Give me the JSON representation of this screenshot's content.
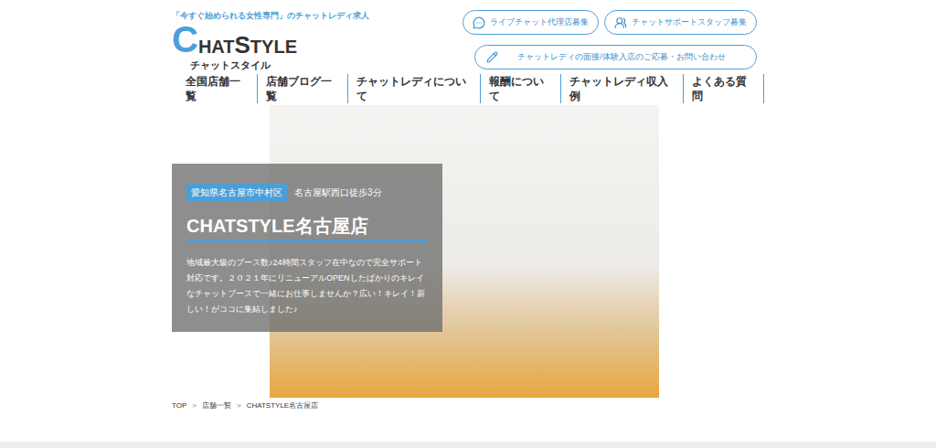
{
  "header": {
    "tagline": "「今すぐ始められる女性専門」のチャットレディ求人",
    "logo": [
      {
        "text": "C",
        "kind": "big"
      },
      {
        "text": "HAT",
        "kind": "small"
      },
      {
        "text": "S",
        "kind": "mid"
      },
      {
        "text": "TYLE",
        "kind": "small"
      }
    ],
    "logo_kana": "チャットスタイル",
    "buttons": [
      {
        "label": "ライブチャット代理店募集",
        "kind": "chat"
      },
      {
        "label": "チャットサポートスタッフ募集",
        "kind": "staff"
      }
    ],
    "contact_button": {
      "label": "チャットレディの面接/体験入店のご応募・お問い合わせ",
      "kind": "pencil"
    }
  },
  "nav": [
    "全国店舗一覧",
    "店舗ブログ一覧",
    "チャットレディについて",
    "報酬について",
    "チャットレディ収入例",
    "よくある質問"
  ],
  "hero": {
    "area": "愛知県名古屋市中村区",
    "access": "名古屋駅西口徒歩3分",
    "title": "CHATSTYLE名古屋店",
    "description": "地域最大級のブース数♪24時間スタッフ在中なので完全サポート対応です。２０２１年にリニューアルOPENしたばかりのキレイなチャットブースで一緒にお仕事しませんか？広い！キレイ！新しい！がココに集結しました♪"
  },
  "breadcrumb": {
    "separator": ">",
    "items": [
      "TOP",
      "店舗一覧",
      "CHATSTYLE名古屋店"
    ]
  }
}
